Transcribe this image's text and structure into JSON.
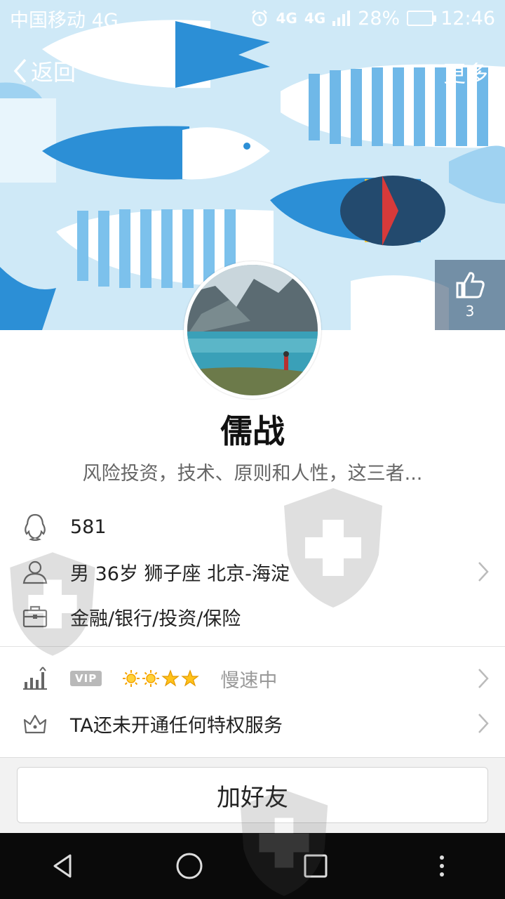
{
  "status_bar": {
    "carrier": "中国移动 4G",
    "network_a": "4G",
    "network_b": "4G",
    "battery": "28%",
    "time": "12:46"
  },
  "nav": {
    "back_label": "返回",
    "more_label": "更多"
  },
  "like": {
    "count": "3"
  },
  "profile": {
    "nickname": "儒战",
    "signature": "风险投资，技术、原则和人性，这三者..."
  },
  "info": {
    "qq_number": "581",
    "basic": "男  36岁  狮子座  北京-海淀",
    "occupation": "金融/银行/投资/保险"
  },
  "vip": {
    "badge": "VIP",
    "level_icons": [
      "sun",
      "sun",
      "star",
      "star"
    ],
    "status": "慢速中"
  },
  "privilege": {
    "text": "TA还未开通任何特权服务"
  },
  "actions": {
    "add_friend": "加好友"
  },
  "colors": {
    "banner_bg": "#d9eef8",
    "fish_blue": "#2c8fd6",
    "accent_gold": "#f5b800"
  }
}
